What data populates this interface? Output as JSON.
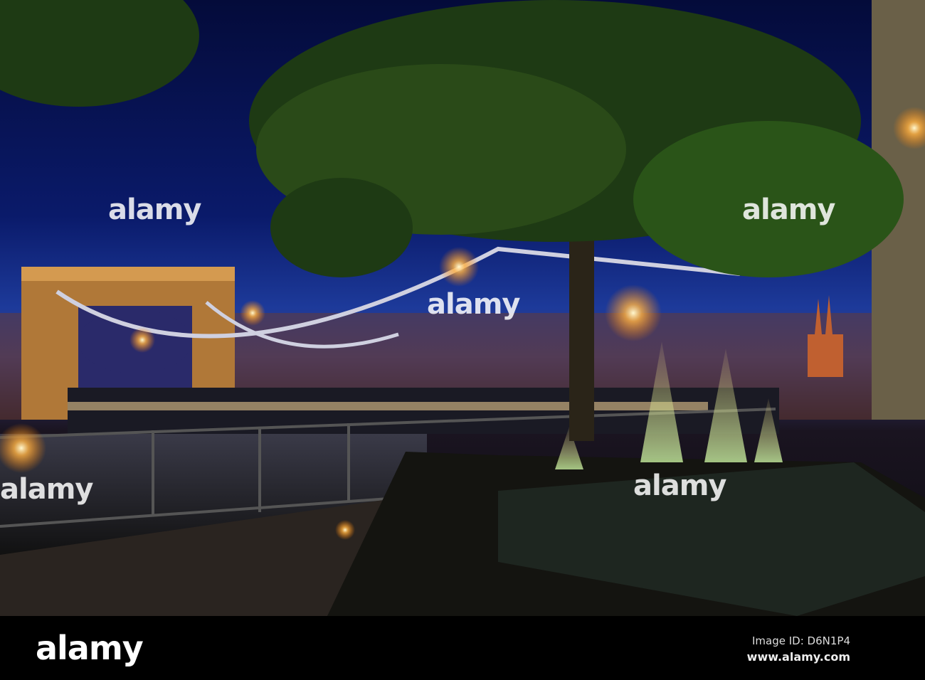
{
  "watermark": "alamy",
  "footer": {
    "logo": "alamy",
    "image_id": "Image ID: D6N1P4",
    "url": "www.alamy.com"
  }
}
